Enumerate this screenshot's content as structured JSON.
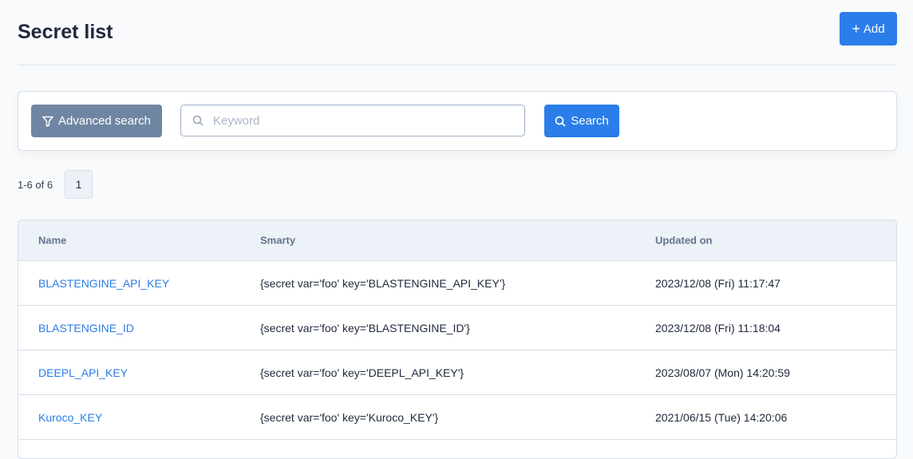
{
  "header": {
    "title": "Secret list",
    "add_label": "Add"
  },
  "search": {
    "advanced_label": "Advanced search",
    "keyword_placeholder": "Keyword",
    "search_label": "Search"
  },
  "pagination": {
    "range": "1-6 of 6",
    "current_page": "1"
  },
  "table": {
    "columns": [
      "Name",
      "Smarty",
      "Updated on"
    ],
    "rows": [
      {
        "name": "BLASTENGINE_API_KEY",
        "smarty": "{secret var='foo' key='BLASTENGINE_API_KEY'}",
        "updated": "2023/12/08 (Fri) 11:17:47"
      },
      {
        "name": "BLASTENGINE_ID",
        "smarty": "{secret var='foo' key='BLASTENGINE_ID'}",
        "updated": "2023/12/08 (Fri) 11:18:04"
      },
      {
        "name": "DEEPL_API_KEY",
        "smarty": "{secret var='foo' key='DEEPL_API_KEY'}",
        "updated": "2023/08/07 (Mon) 14:20:59"
      },
      {
        "name": "Kuroco_KEY",
        "smarty": "{secret var='foo' key='Kuroco_KEY'}",
        "updated": "2021/06/15 (Tue) 14:20:06"
      }
    ]
  }
}
